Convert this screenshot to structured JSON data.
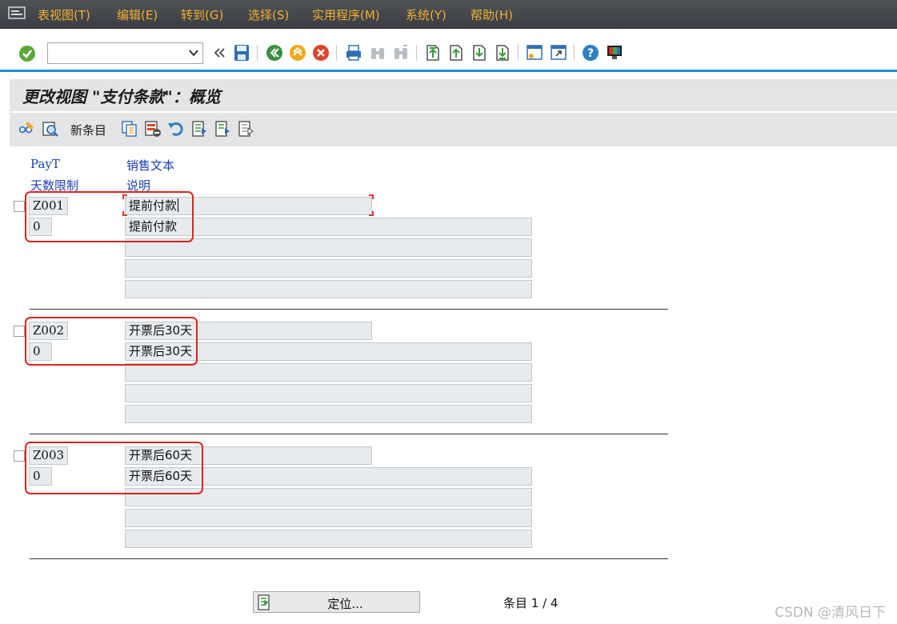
{
  "menu": {
    "items": [
      "表视图(T)",
      "编辑(E)",
      "转到(G)",
      "选择(S)",
      "实用程序(M)",
      "系统(Y)",
      "帮助(H)"
    ]
  },
  "toolbar": {
    "command_value": ""
  },
  "title": "更改视图 \"支付条款\"：概览",
  "app_toolbar": {
    "new_entries_label": "新条目"
  },
  "columns": {
    "payt": "PayT",
    "sales_text": "销售文本",
    "day_limit": "天数限制",
    "description": "说明"
  },
  "rows": [
    {
      "payt": "Z001",
      "day_limit": "0",
      "sales_text": "提前付款",
      "description": "提前付款"
    },
    {
      "payt": "Z002",
      "day_limit": "0",
      "sales_text": "开票后30天",
      "description": "开票后30天"
    },
    {
      "payt": "Z003",
      "day_limit": "0",
      "sales_text": "开票后60天",
      "description": "开票后60天"
    }
  ],
  "position_button_label": "定位...",
  "entry_counter": "条目 1 / 4",
  "watermark": "CSDN @清风日下",
  "colors": {
    "menu_text": "#f0b030",
    "header_text": "#1a3fb5",
    "highlight": "#e2231a",
    "toolbar_underline": "#1e8fd6"
  }
}
